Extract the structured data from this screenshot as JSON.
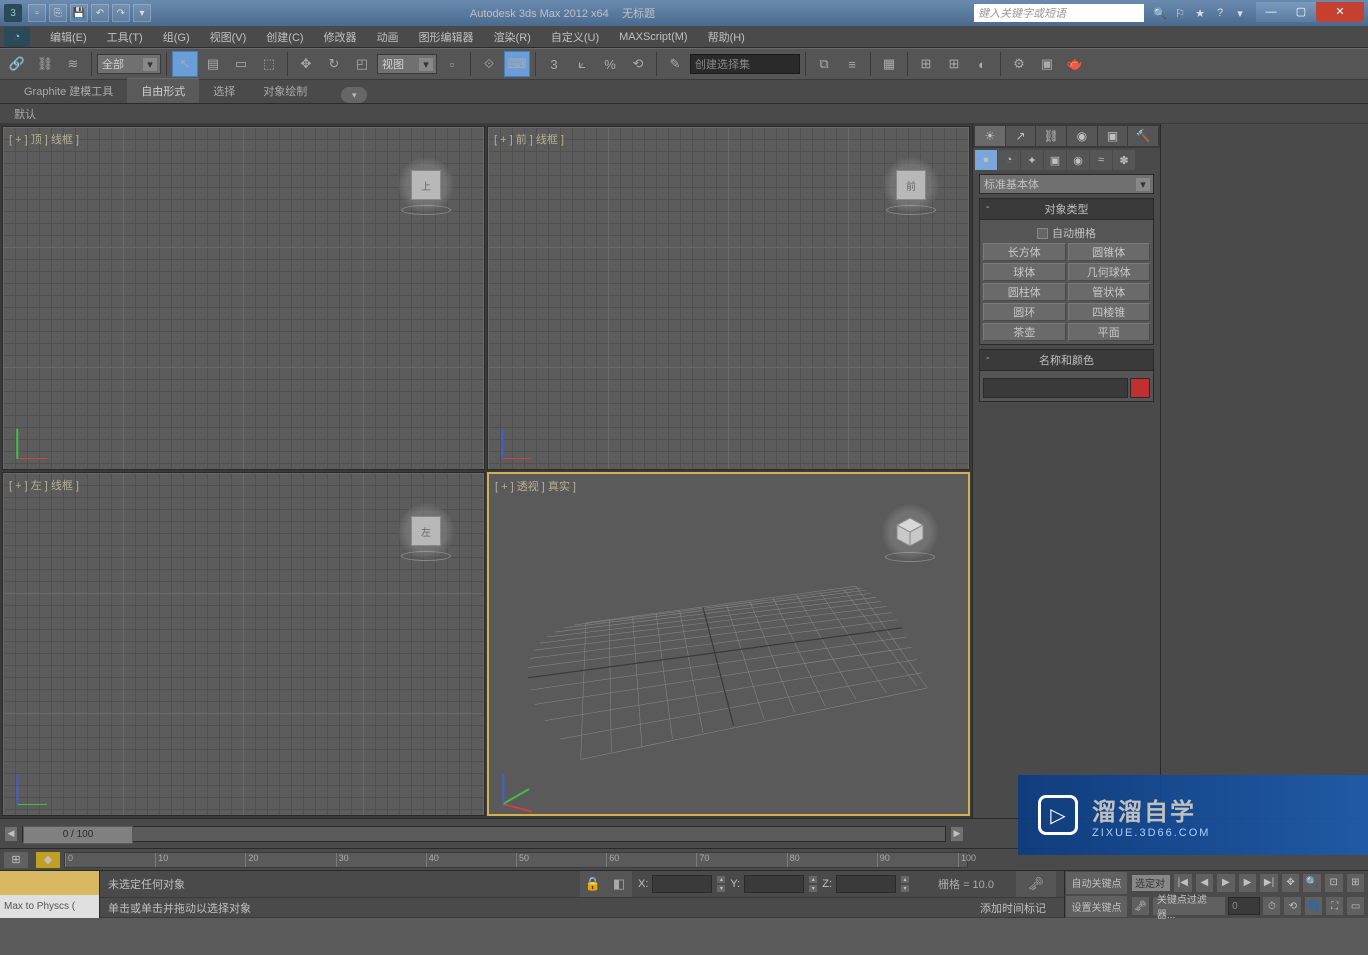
{
  "title": {
    "app": "Autodesk 3ds Max  2012 x64",
    "doc": "无标题"
  },
  "search": {
    "placeholder": "键入关键字或短语"
  },
  "menus": [
    "编辑(E)",
    "工具(T)",
    "组(G)",
    "视图(V)",
    "创建(C)",
    "修改器",
    "动画",
    "图形编辑器",
    "渲染(R)",
    "自定义(U)",
    "MAXScript(M)",
    "帮助(H)"
  ],
  "toolbar": {
    "filter_combo": "全部",
    "ref_combo": "视图",
    "selset_placeholder": "创建选择集"
  },
  "ribbon": {
    "tabs": [
      "Graphite 建模工具",
      "自由形式",
      "选择",
      "对象绘制"
    ],
    "active": 1,
    "sub": "默认"
  },
  "viewports": {
    "tl": "[ + ] 顶 ] 线框 ]",
    "tr": "[ + ] 前 ] 线框 ]",
    "bl": "[ + ] 左 ] 线框 ]",
    "br": "[ + ] 透视 ] 真实 ]",
    "cubes": {
      "tl": "上",
      "tr": "前",
      "bl": "左"
    }
  },
  "command_panel": {
    "category": "标准基本体",
    "rollout_type": "对象类型",
    "autogrid": "自动栅格",
    "buttons": [
      "长方体",
      "圆锥体",
      "球体",
      "几何球体",
      "圆柱体",
      "管状体",
      "圆环",
      "四棱锥",
      "茶壶",
      "平面"
    ],
    "rollout_name": "名称和颜色"
  },
  "timeslider": {
    "label": "0 / 100"
  },
  "trackbar": {
    "ticks": [
      0,
      10,
      20,
      30,
      40,
      50,
      60,
      70,
      80,
      90,
      100
    ]
  },
  "status": {
    "script": "Max to Physcs (",
    "line1": "未选定任何对象",
    "line2": "单击或单击并拖动以选择对象",
    "x": "X:",
    "y": "Y:",
    "z": "Z:",
    "grid": "栅格 = 10.0",
    "autokey": "自动关键点",
    "setkey": "设置关键点",
    "selmode": "选定对",
    "addtime": "添加时间标记",
    "keyfilter": "关键点过滤器..."
  },
  "watermark": {
    "title": "溜溜自学",
    "sub": "ZIXUE.3D66.COM"
  },
  "icons": {
    "undo": "↶",
    "redo": "↷",
    "link": "🔗",
    "unlink": "⛓",
    "bind": "≋",
    "select": "↖",
    "rect": "▭",
    "window": "⬚",
    "move": "✥",
    "rotate": "↻",
    "scale": "◰",
    "snap": "3",
    "angle": "⟀",
    "percent": "%",
    "mirror": "⧉",
    "align": "≡",
    "layers": "▦",
    "schematic": "⊞",
    "material": "◐",
    "render": "🫖",
    "create": "☀",
    "modify": "↗",
    "hierarchy": "⛓",
    "motion": "◉",
    "display": "▣",
    "utilities": "🔨",
    "geom": "●",
    "shapes": "◔",
    "lights": "✦",
    "cameras": "▣",
    "helpers": "◉",
    "space": "≈",
    "systems": "✽",
    "lock": "🔒",
    "key": "🗝",
    "play": "▶",
    "prev": "◀",
    "next": "▶",
    "goto": "▷|"
  }
}
